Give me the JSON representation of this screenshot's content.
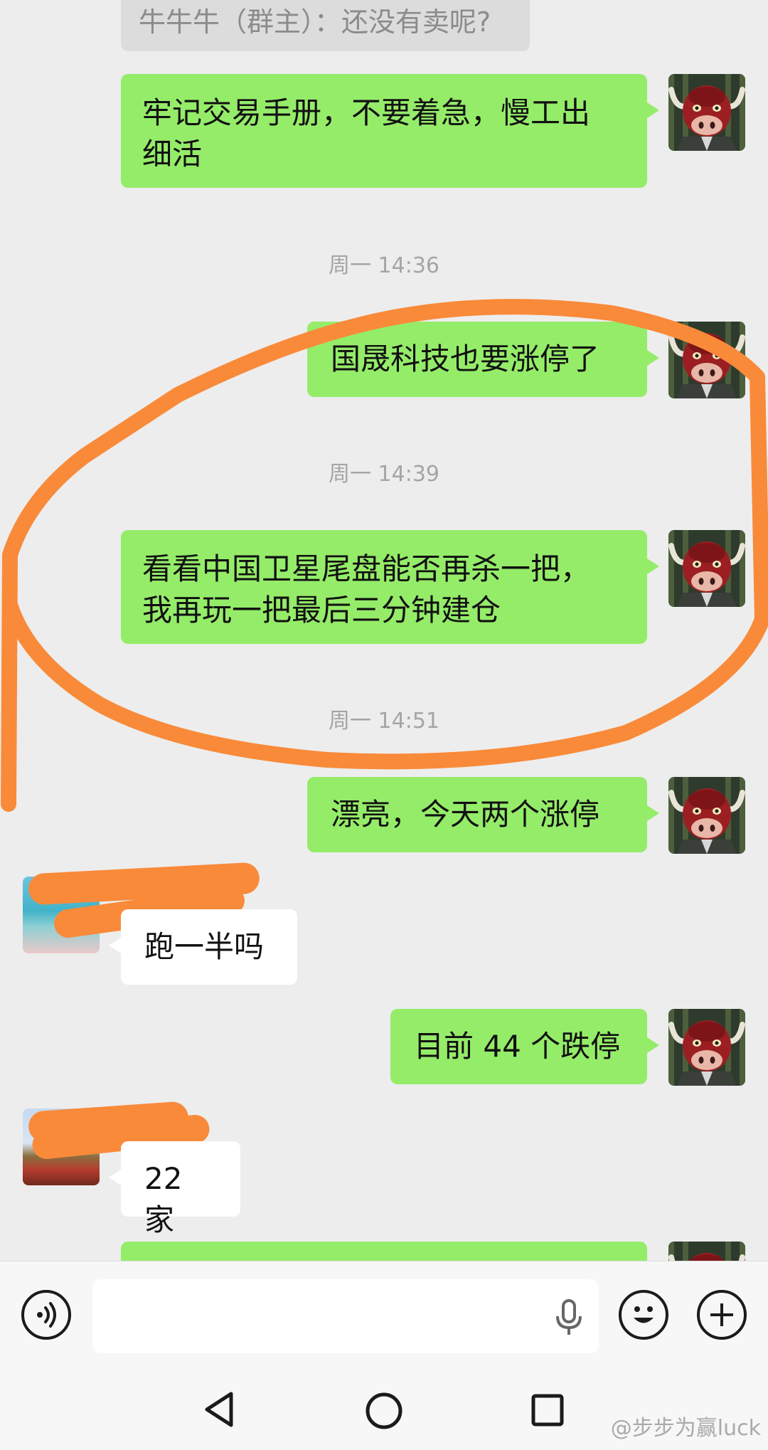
{
  "system_message": "牛牛牛（群主）：还没有卖呢?",
  "messages": [
    {
      "sender": "me",
      "text_lines": [
        "牢记交易手册，不要着急，慢工出",
        "细活"
      ]
    },
    {
      "time": "周一 14:36"
    },
    {
      "sender": "me",
      "text_lines": [
        "国晟科技也要涨停了"
      ]
    },
    {
      "time": "周一 14:39"
    },
    {
      "sender": "me",
      "text_lines": [
        "看看中国卫星尾盘能否再杀一把，",
        "我再玩一把最后三分钟建仓"
      ]
    },
    {
      "time": "周一 14:51"
    },
    {
      "sender": "me",
      "text_lines": [
        "漂亮，今天两个涨停"
      ]
    },
    {
      "sender": "other",
      "text_lines": [
        "跑一半吗"
      ]
    },
    {
      "sender": "me",
      "text_lines": [
        "目前 44 个跌停"
      ]
    },
    {
      "sender": "other",
      "text_lines": [
        "22 家"
      ]
    }
  ],
  "input_bar": {
    "voice_icon": "voice-wave-icon",
    "mic_icon": "microphone-icon",
    "emoji_icon": "smiley-icon",
    "plus_icon": "plus-icon"
  },
  "nav_bar": {
    "back_icon": "triangle-back-icon",
    "home_icon": "circle-home-icon",
    "recents_icon": "square-recents-icon"
  },
  "watermark": "@步步为赢luck",
  "colors": {
    "outgoing_bubble": "#95ec69",
    "incoming_bubble": "#ffffff",
    "background": "#ededed",
    "annotation": "#f98a39"
  }
}
